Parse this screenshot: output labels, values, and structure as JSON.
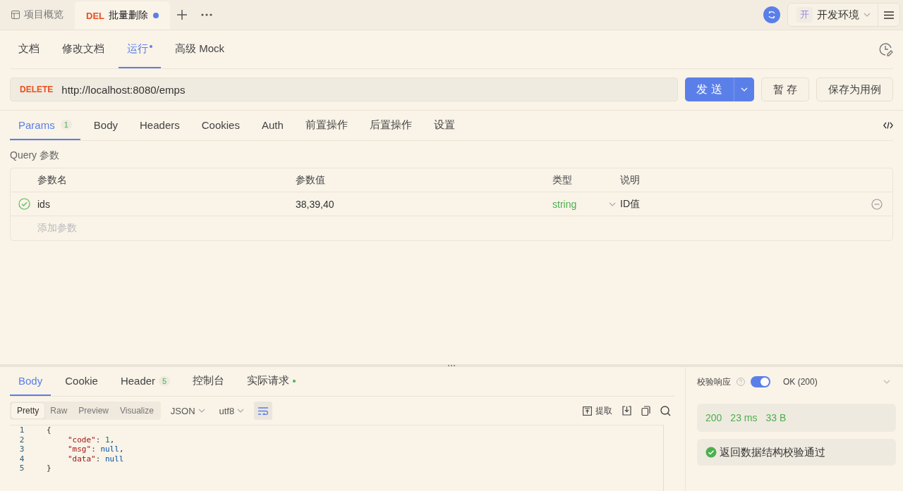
{
  "top_tabs": [
    {
      "kind": "overview",
      "label": "项目概览",
      "selected": false,
      "unsaved": false
    },
    {
      "kind": "request",
      "method": "DEL",
      "label": "批量删除",
      "selected": true,
      "unsaved": true
    }
  ],
  "environment": {
    "badge": "开",
    "label": "开发环境"
  },
  "doc_tabs": [
    {
      "label": "文档",
      "selected": false,
      "dot": false
    },
    {
      "label": "修改文档",
      "selected": false,
      "dot": false
    },
    {
      "label": "运行",
      "selected": true,
      "dot": true
    },
    {
      "label": "高级 Mock",
      "selected": false,
      "dot": false
    }
  ],
  "request": {
    "method": "DELETE",
    "url": "http://localhost:8080/emps",
    "send": "发 送",
    "save": "暂 存",
    "save_case": "保存为用例"
  },
  "param_tabs": [
    {
      "label": "Params",
      "badge": "1",
      "selected": true
    },
    {
      "label": "Body",
      "selected": false
    },
    {
      "label": "Headers",
      "selected": false
    },
    {
      "label": "Cookies",
      "selected": false
    },
    {
      "label": "Auth",
      "selected": false
    },
    {
      "label": "前置操作",
      "selected": false
    },
    {
      "label": "后置操作",
      "selected": false
    },
    {
      "label": "设置",
      "selected": false
    }
  ],
  "query": {
    "title": "Query 参数",
    "columns": [
      "参数名",
      "参数值",
      "类型",
      "说明"
    ],
    "rows": [
      {
        "enabled": true,
        "name": "ids",
        "value": "38,39,40",
        "type": "string",
        "description": "ID值"
      }
    ],
    "add_placeholder": "添加参数"
  },
  "response_tabs": [
    {
      "label": "Body",
      "selected": true,
      "dot": false
    },
    {
      "label": "Cookie",
      "selected": false,
      "dot": false
    },
    {
      "label": "Header",
      "badge": "5",
      "selected": false,
      "dot": false
    },
    {
      "label": "控制台",
      "selected": false,
      "dot": false
    },
    {
      "label": "实际请求",
      "selected": false,
      "dot": true
    }
  ],
  "view_modes": [
    {
      "label": "Pretty",
      "selected": true
    },
    {
      "label": "Raw",
      "selected": false
    },
    {
      "label": "Preview",
      "selected": false
    },
    {
      "label": "Visualize",
      "selected": false
    }
  ],
  "format": "JSON",
  "encoding": "utf8",
  "wrap": {
    "on": true
  },
  "extract": "提取",
  "code_lines": [
    {
      "number": "1",
      "tokens": [
        {
          "kind": "punct",
          "text": "{"
        }
      ]
    },
    {
      "number": "2",
      "tokens": [
        {
          "kind": "key",
          "text": "\"code\""
        },
        {
          "kind": "punct",
          "text": ": "
        },
        {
          "kind": "number",
          "text": "1"
        },
        {
          "kind": "punct",
          "text": ","
        }
      ]
    },
    {
      "number": "3",
      "tokens": [
        {
          "kind": "key",
          "text": "\"msg\""
        },
        {
          "kind": "punct",
          "text": ": "
        },
        {
          "kind": "null",
          "text": "null"
        },
        {
          "kind": "punct",
          "text": ","
        }
      ]
    },
    {
      "number": "4",
      "tokens": [
        {
          "kind": "key",
          "text": "\"data\""
        },
        {
          "kind": "punct",
          "text": ": "
        },
        {
          "kind": "null",
          "text": "null"
        }
      ]
    },
    {
      "number": "5",
      "tokens": [
        {
          "kind": "punct",
          "text": "}"
        }
      ]
    }
  ],
  "validation": {
    "label": "校验响应",
    "on": true,
    "status": "OK (200)",
    "stats": [
      "200",
      "23 ms",
      "33 B"
    ],
    "result": "返回数据结构校验通过",
    "passed": true
  }
}
